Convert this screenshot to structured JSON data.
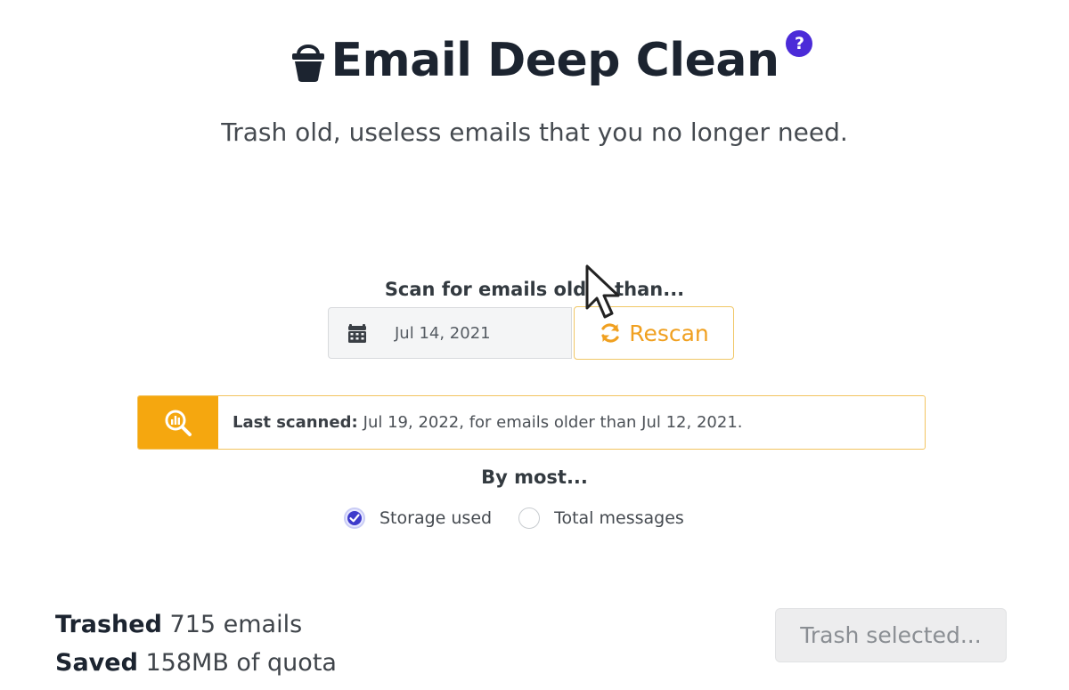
{
  "header": {
    "title": "Email Deep Clean",
    "help_badge": "?",
    "icon": "bucket-icon"
  },
  "subtitle": "Trash old, useless emails that you no longer need.",
  "scan": {
    "label": "Scan for emails older than...",
    "date_value": "Jul 14, 2021",
    "calendar_icon": "calendar-icon",
    "rescan_label": "Rescan",
    "rescan_icon": "refresh-icon"
  },
  "banner": {
    "icon": "search-chart-icon",
    "strong": "Last scanned:",
    "text": "Jul 19, 2022, for emails older than Jul 12, 2021."
  },
  "sort": {
    "label": "By most...",
    "options": [
      {
        "label": "Storage used",
        "checked": true
      },
      {
        "label": "Total messages",
        "checked": false
      }
    ]
  },
  "stats": {
    "trashed_label": "Trashed",
    "trashed_value": "715 emails",
    "saved_label": "Saved",
    "saved_value": "158MB of quota"
  },
  "actions": {
    "trash_selected": "Trash selected..."
  },
  "colors": {
    "accent_orange": "#f5a70f",
    "help_purple": "#4b2bd8",
    "title_dark": "#1c2430"
  }
}
